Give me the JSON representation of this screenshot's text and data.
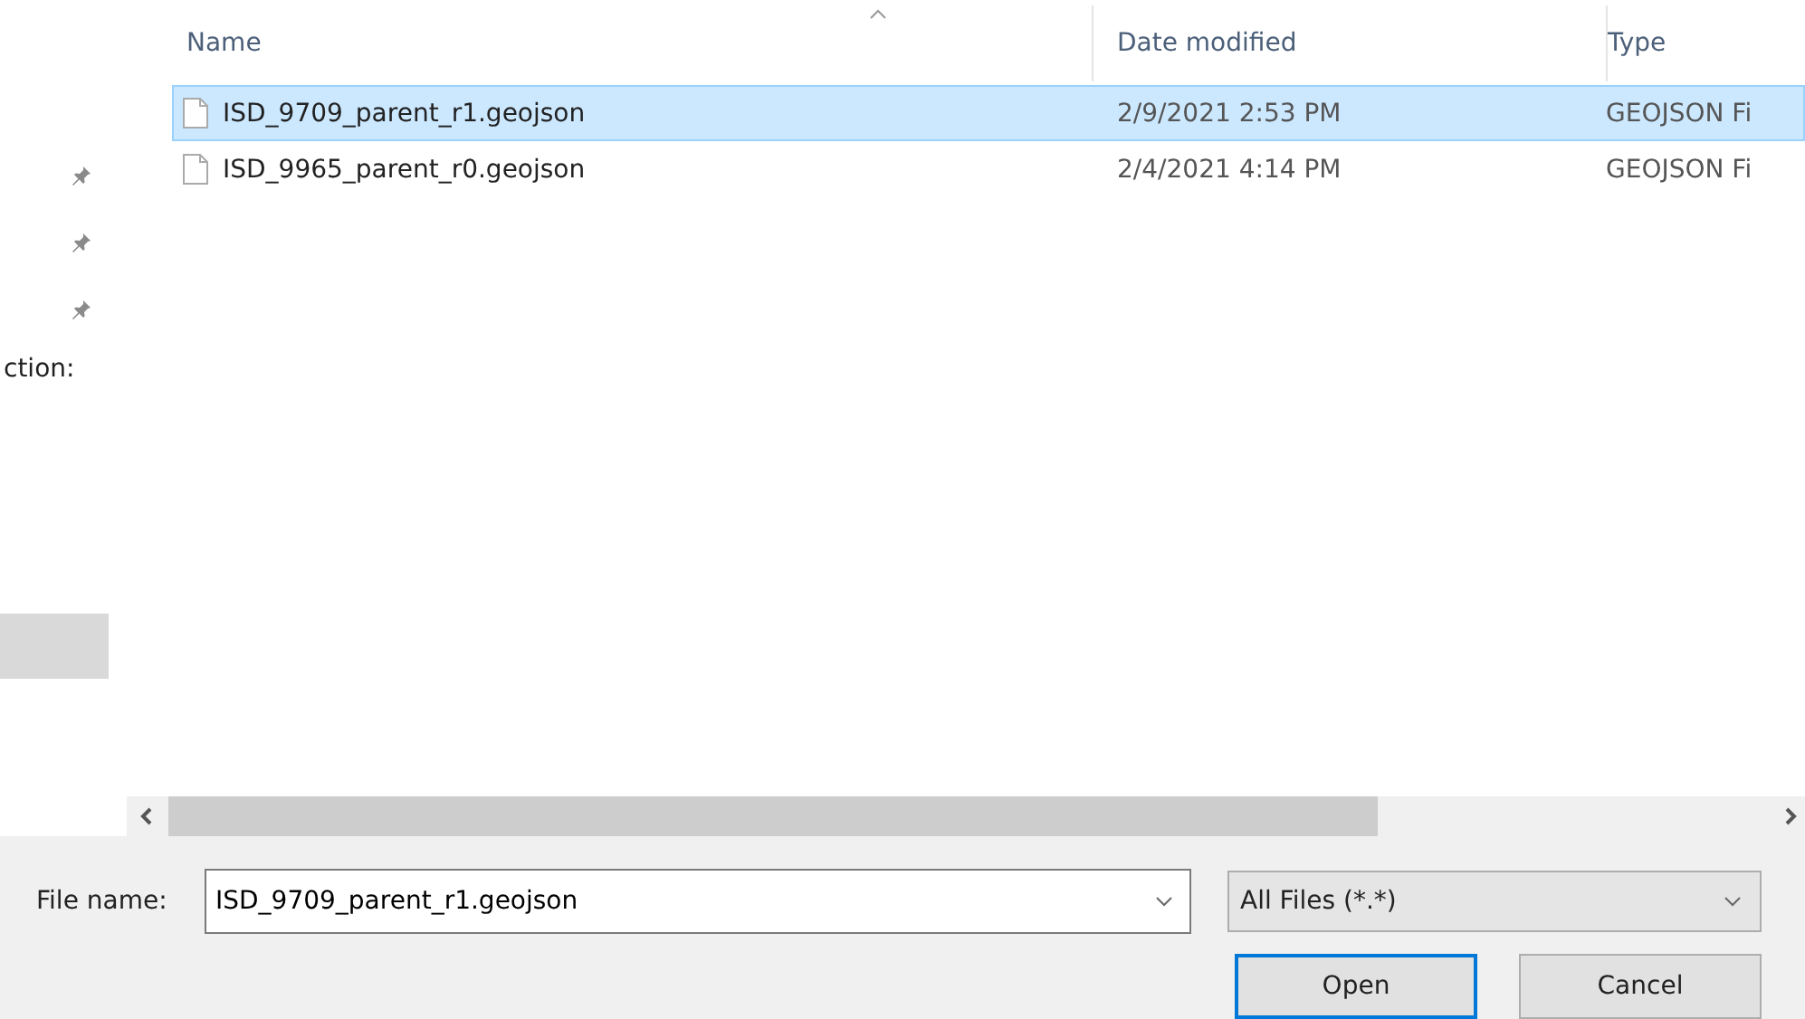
{
  "sidebar": {
    "items": [
      {
        "kind": "pin"
      },
      {
        "kind": "pin"
      },
      {
        "kind": "pin"
      },
      {
        "kind": "text",
        "label": "ction:"
      },
      {
        "kind": "blank",
        "selected": true
      }
    ]
  },
  "file_list": {
    "columns": [
      "Name",
      "Date modified",
      "Type"
    ],
    "rows": [
      {
        "name": "ISD_9709_parent_r1.geojson",
        "date": "2/9/2021 2:53 PM",
        "type": "GEOJSON Fi",
        "selected": true
      },
      {
        "name": "ISD_9965_parent_r0.geojson",
        "date": "2/4/2021 4:14 PM",
        "type": "GEOJSON Fi",
        "selected": false
      }
    ]
  },
  "file_name": {
    "label": "File name:",
    "value": "ISD_9709_parent_r1.geojson"
  },
  "file_type": {
    "value": "All Files (*.*)"
  },
  "buttons": [
    "Open",
    "Cancel"
  ]
}
